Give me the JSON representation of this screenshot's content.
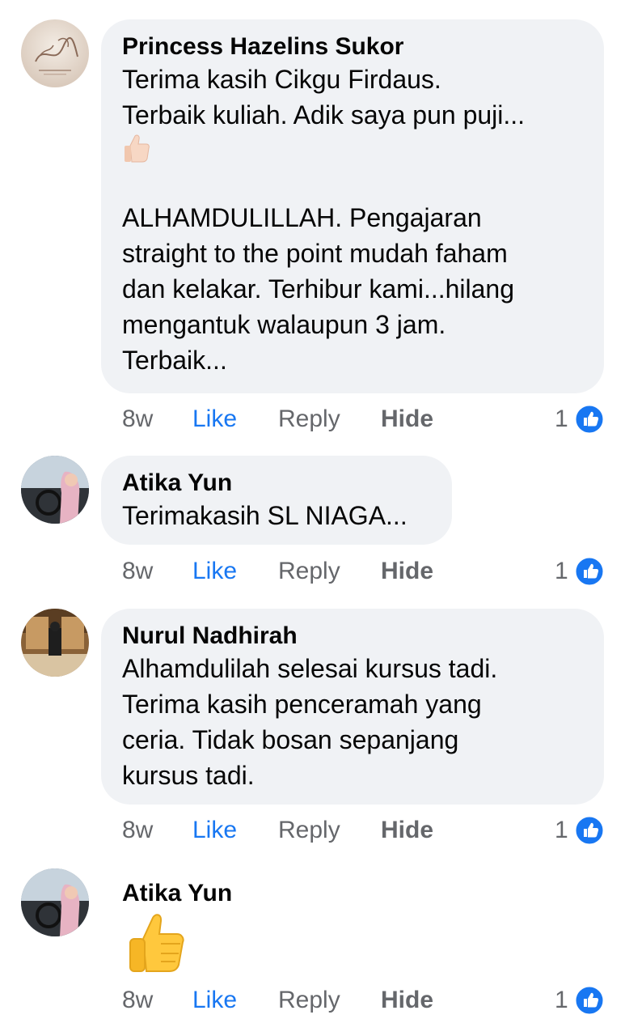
{
  "comments": [
    {
      "author": "Princess Hazelins Sukor",
      "text_1": "Terima kasih Cikgu Firdaus.\nTerbaik kuliah. Adik saya pun puji...",
      "text_2": "ALHAMDULILLAH. Pengajaran\nstraight to the point mudah faham\ndan kelakar. Terhibur kami...hilang\nmengantuk walaupun 3 jam.\nTerbaik...",
      "time": "8w",
      "like": "Like",
      "reply": "Reply",
      "hide": "Hide",
      "reactions": "1"
    },
    {
      "author": "Atika Yun",
      "text_1": "Terimakasih SL NIAGA...",
      "time": "8w",
      "like": "Like",
      "reply": "Reply",
      "hide": "Hide",
      "reactions": "1"
    },
    {
      "author": "Nurul Nadhirah",
      "text_1": "Alhamdulilah selesai kursus tadi.\nTerima kasih penceramah yang\nceria. Tidak bosan sepanjang\nkursus tadi.",
      "time": "8w",
      "like": "Like",
      "reply": "Reply",
      "hide": "Hide",
      "reactions": "1"
    },
    {
      "author": "Atika Yun",
      "time": "8w",
      "like": "Like",
      "reply": "Reply",
      "hide": "Hide",
      "reactions": "1"
    }
  ],
  "icons": {
    "thumbs_up_emoji": "thumbs-up-emoji-icon",
    "like_reaction": "like-reaction-icon"
  },
  "colors": {
    "like_blue": "#1877f2",
    "bubble_bg": "#f0f2f5",
    "meta_gray": "#65676b"
  }
}
